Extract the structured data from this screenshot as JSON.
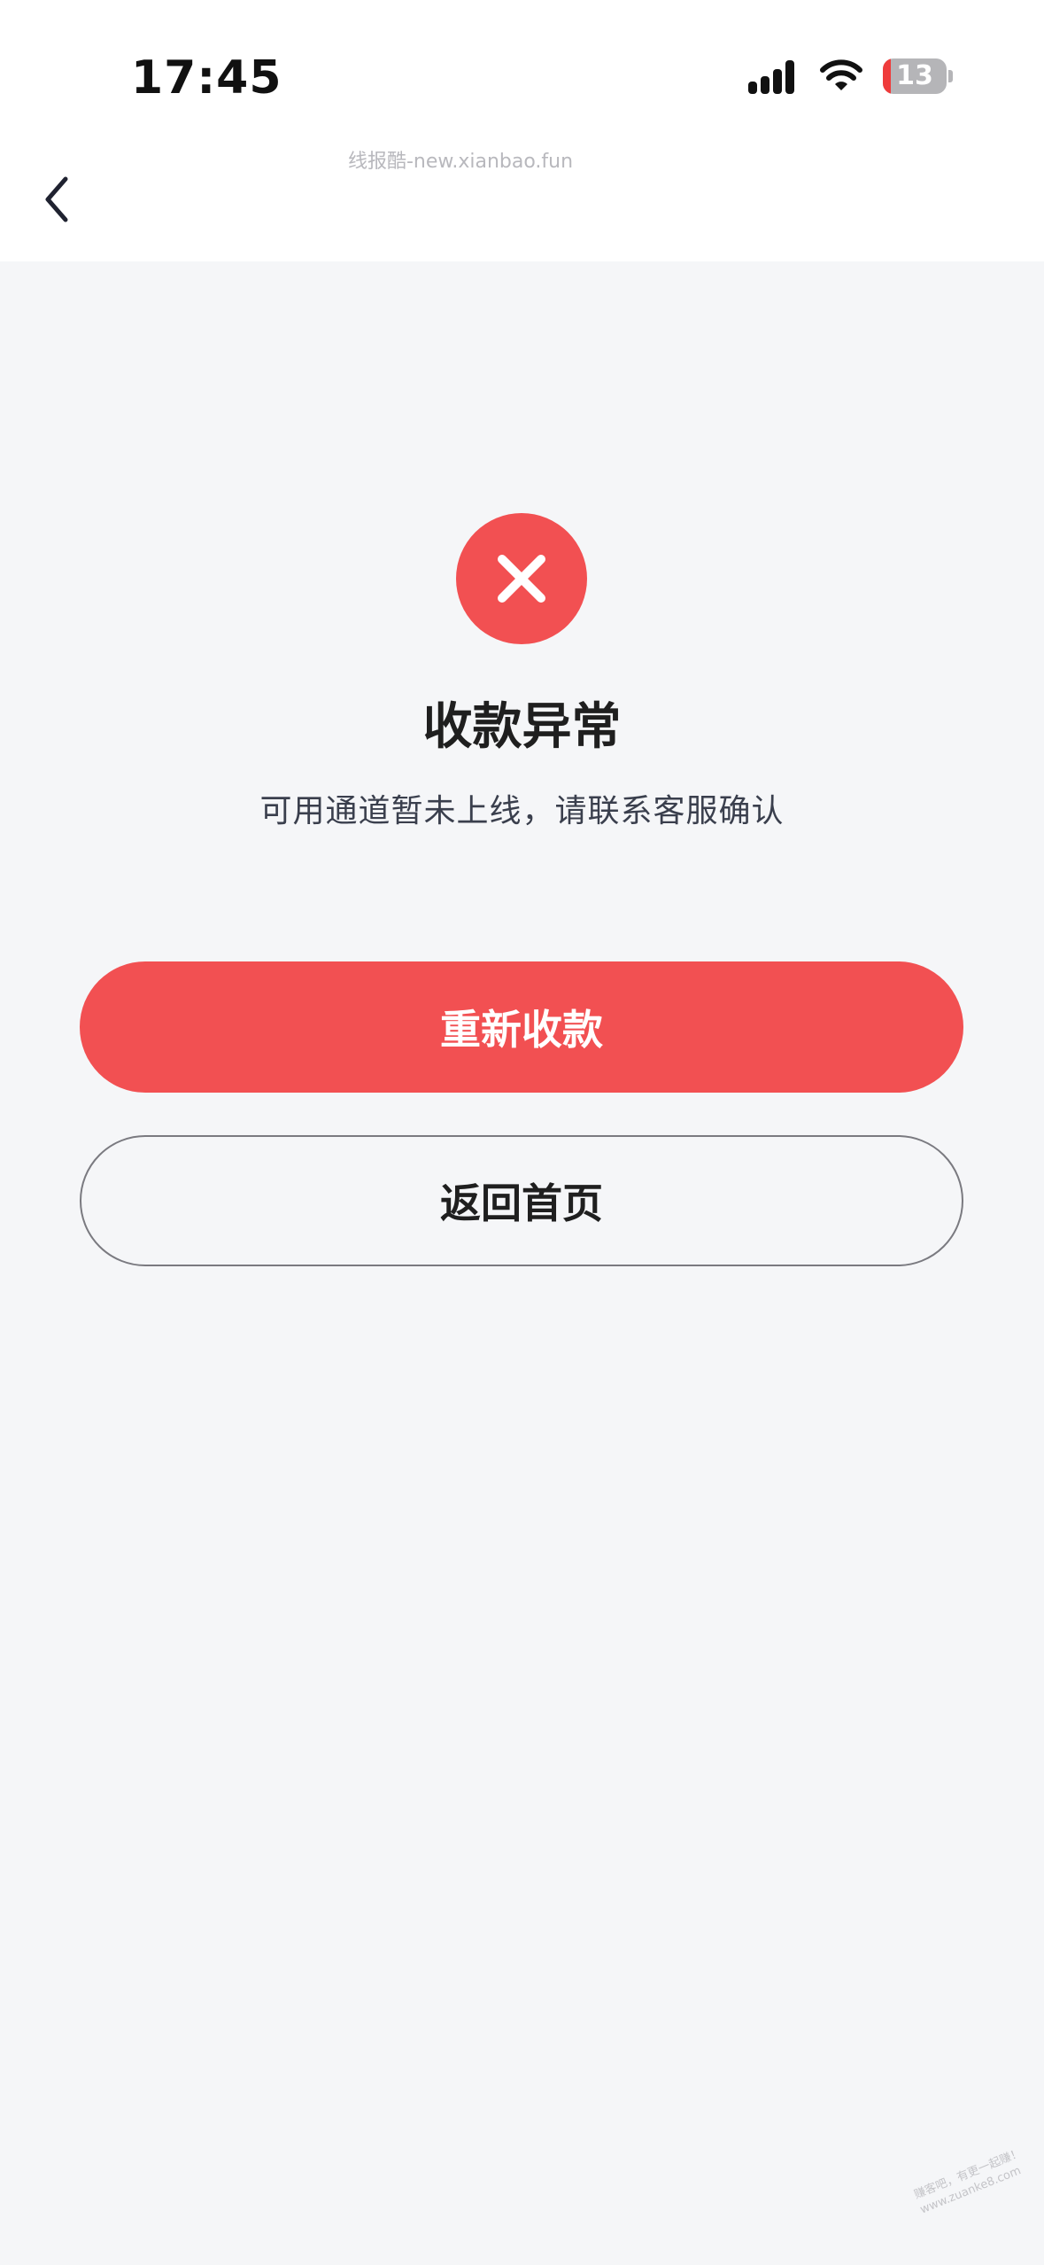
{
  "status_bar": {
    "time": "17:45",
    "battery_level": "13",
    "battery_fraction": 0.13,
    "icons": [
      "signal-icon",
      "wifi-icon",
      "battery-icon"
    ]
  },
  "header": {
    "watermark": "线报酷-new.xianbao.fun",
    "back_icon": "chevron-left-icon"
  },
  "result": {
    "icon": "close-icon",
    "title": "收款异常",
    "message": "可用通道暂未上线，请联系客服确认"
  },
  "actions": {
    "retry_label": "重新收款",
    "home_label": "返回首页"
  },
  "footer_watermark": {
    "line1": "赚客吧，有更一起赚！",
    "line2": "www.zuanke8.com"
  },
  "colors": {
    "accent": "#f25052",
    "background": "#f5f6f8",
    "header_background": "#ffffff"
  }
}
